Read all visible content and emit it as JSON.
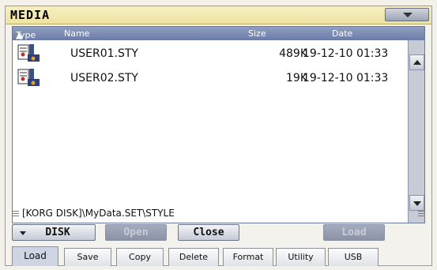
{
  "window": {
    "title": "MEDIA"
  },
  "list_header": {
    "type": "Type",
    "name": "Name",
    "size": "Size",
    "date": "Date"
  },
  "files": [
    {
      "icon": "style-file-icon",
      "name": "USER01.STY",
      "size": "489K",
      "date": "19-12-10 01:33"
    },
    {
      "icon": "style-file-icon",
      "name": "USER02.STY",
      "size": "19K",
      "date": "19-12-10 01:33"
    }
  ],
  "path": "[KORG DISK]\\MyData.SET\\STYLE",
  "buttons": {
    "disk": "DISK",
    "open": "Open",
    "close": "Close",
    "load": "Load"
  },
  "tabs": [
    {
      "label": "Load",
      "selected": true
    },
    {
      "label": "Save",
      "selected": false
    },
    {
      "label": "Copy",
      "selected": false
    },
    {
      "label": "Delete",
      "selected": false
    },
    {
      "label": "Format",
      "selected": false
    },
    {
      "label": "Utility",
      "selected": false
    },
    {
      "label": "USB",
      "selected": false
    }
  ],
  "colors": {
    "title_bar": "#efe3a0",
    "header_bar": "#7a89b1",
    "button_disabled": "#98a0b2"
  }
}
